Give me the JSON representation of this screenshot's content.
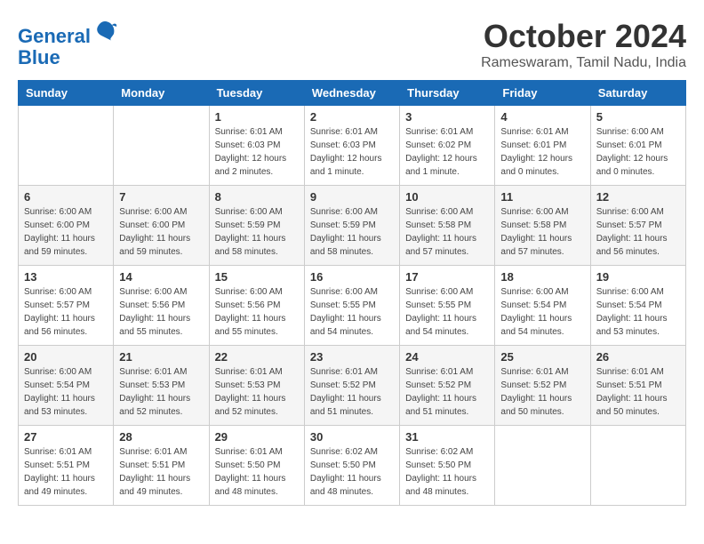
{
  "logo": {
    "line1": "General",
    "line2": "Blue"
  },
  "title": "October 2024",
  "location": "Rameswaram, Tamil Nadu, India",
  "weekdays": [
    "Sunday",
    "Monday",
    "Tuesday",
    "Wednesday",
    "Thursday",
    "Friday",
    "Saturday"
  ],
  "weeks": [
    [
      {
        "day": "",
        "info": ""
      },
      {
        "day": "",
        "info": ""
      },
      {
        "day": "1",
        "info": "Sunrise: 6:01 AM\nSunset: 6:03 PM\nDaylight: 12 hours\nand 2 minutes."
      },
      {
        "day": "2",
        "info": "Sunrise: 6:01 AM\nSunset: 6:03 PM\nDaylight: 12 hours\nand 1 minute."
      },
      {
        "day": "3",
        "info": "Sunrise: 6:01 AM\nSunset: 6:02 PM\nDaylight: 12 hours\nand 1 minute."
      },
      {
        "day": "4",
        "info": "Sunrise: 6:01 AM\nSunset: 6:01 PM\nDaylight: 12 hours\nand 0 minutes."
      },
      {
        "day": "5",
        "info": "Sunrise: 6:00 AM\nSunset: 6:01 PM\nDaylight: 12 hours\nand 0 minutes."
      }
    ],
    [
      {
        "day": "6",
        "info": "Sunrise: 6:00 AM\nSunset: 6:00 PM\nDaylight: 11 hours\nand 59 minutes."
      },
      {
        "day": "7",
        "info": "Sunrise: 6:00 AM\nSunset: 6:00 PM\nDaylight: 11 hours\nand 59 minutes."
      },
      {
        "day": "8",
        "info": "Sunrise: 6:00 AM\nSunset: 5:59 PM\nDaylight: 11 hours\nand 58 minutes."
      },
      {
        "day": "9",
        "info": "Sunrise: 6:00 AM\nSunset: 5:59 PM\nDaylight: 11 hours\nand 58 minutes."
      },
      {
        "day": "10",
        "info": "Sunrise: 6:00 AM\nSunset: 5:58 PM\nDaylight: 11 hours\nand 57 minutes."
      },
      {
        "day": "11",
        "info": "Sunrise: 6:00 AM\nSunset: 5:58 PM\nDaylight: 11 hours\nand 57 minutes."
      },
      {
        "day": "12",
        "info": "Sunrise: 6:00 AM\nSunset: 5:57 PM\nDaylight: 11 hours\nand 56 minutes."
      }
    ],
    [
      {
        "day": "13",
        "info": "Sunrise: 6:00 AM\nSunset: 5:57 PM\nDaylight: 11 hours\nand 56 minutes."
      },
      {
        "day": "14",
        "info": "Sunrise: 6:00 AM\nSunset: 5:56 PM\nDaylight: 11 hours\nand 55 minutes."
      },
      {
        "day": "15",
        "info": "Sunrise: 6:00 AM\nSunset: 5:56 PM\nDaylight: 11 hours\nand 55 minutes."
      },
      {
        "day": "16",
        "info": "Sunrise: 6:00 AM\nSunset: 5:55 PM\nDaylight: 11 hours\nand 54 minutes."
      },
      {
        "day": "17",
        "info": "Sunrise: 6:00 AM\nSunset: 5:55 PM\nDaylight: 11 hours\nand 54 minutes."
      },
      {
        "day": "18",
        "info": "Sunrise: 6:00 AM\nSunset: 5:54 PM\nDaylight: 11 hours\nand 54 minutes."
      },
      {
        "day": "19",
        "info": "Sunrise: 6:00 AM\nSunset: 5:54 PM\nDaylight: 11 hours\nand 53 minutes."
      }
    ],
    [
      {
        "day": "20",
        "info": "Sunrise: 6:00 AM\nSunset: 5:54 PM\nDaylight: 11 hours\nand 53 minutes."
      },
      {
        "day": "21",
        "info": "Sunrise: 6:01 AM\nSunset: 5:53 PM\nDaylight: 11 hours\nand 52 minutes."
      },
      {
        "day": "22",
        "info": "Sunrise: 6:01 AM\nSunset: 5:53 PM\nDaylight: 11 hours\nand 52 minutes."
      },
      {
        "day": "23",
        "info": "Sunrise: 6:01 AM\nSunset: 5:52 PM\nDaylight: 11 hours\nand 51 minutes."
      },
      {
        "day": "24",
        "info": "Sunrise: 6:01 AM\nSunset: 5:52 PM\nDaylight: 11 hours\nand 51 minutes."
      },
      {
        "day": "25",
        "info": "Sunrise: 6:01 AM\nSunset: 5:52 PM\nDaylight: 11 hours\nand 50 minutes."
      },
      {
        "day": "26",
        "info": "Sunrise: 6:01 AM\nSunset: 5:51 PM\nDaylight: 11 hours\nand 50 minutes."
      }
    ],
    [
      {
        "day": "27",
        "info": "Sunrise: 6:01 AM\nSunset: 5:51 PM\nDaylight: 11 hours\nand 49 minutes."
      },
      {
        "day": "28",
        "info": "Sunrise: 6:01 AM\nSunset: 5:51 PM\nDaylight: 11 hours\nand 49 minutes."
      },
      {
        "day": "29",
        "info": "Sunrise: 6:01 AM\nSunset: 5:50 PM\nDaylight: 11 hours\nand 48 minutes."
      },
      {
        "day": "30",
        "info": "Sunrise: 6:02 AM\nSunset: 5:50 PM\nDaylight: 11 hours\nand 48 minutes."
      },
      {
        "day": "31",
        "info": "Sunrise: 6:02 AM\nSunset: 5:50 PM\nDaylight: 11 hours\nand 48 minutes."
      },
      {
        "day": "",
        "info": ""
      },
      {
        "day": "",
        "info": ""
      }
    ]
  ]
}
